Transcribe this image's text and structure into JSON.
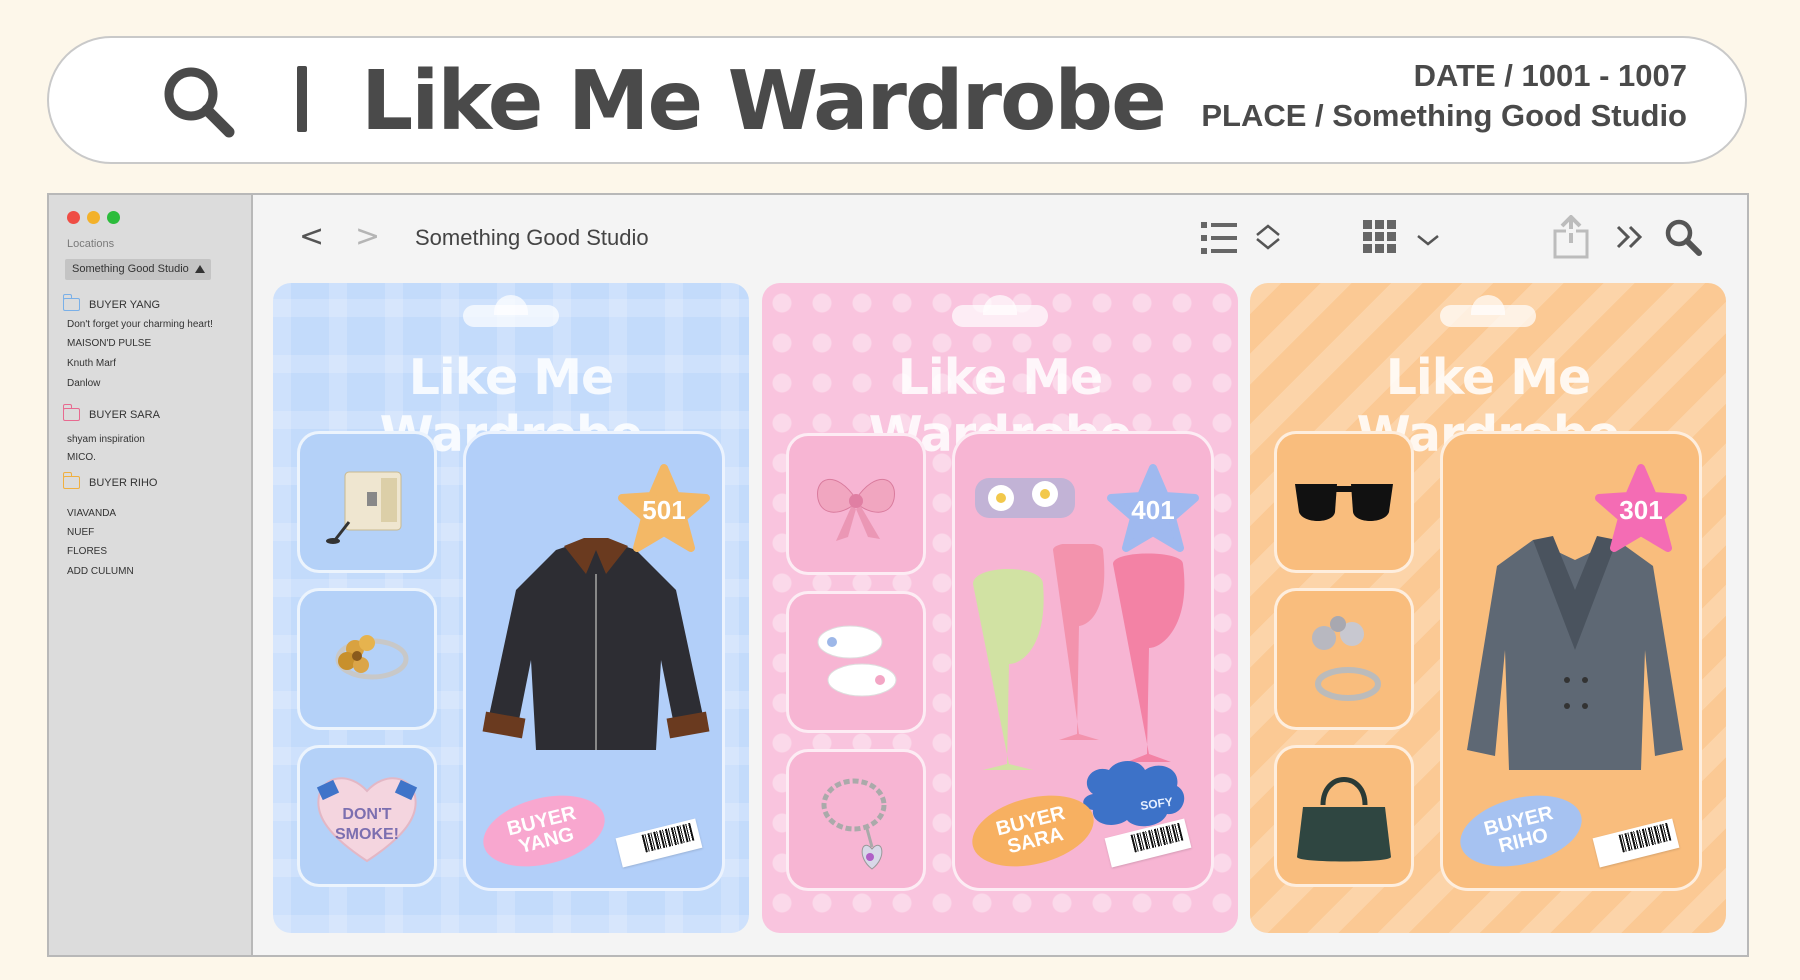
{
  "header": {
    "title": "Like Me Wardrobe",
    "date_line": "DATE / 1001 - 1007",
    "place_line": "PLACE / Something Good Studio"
  },
  "sidebar": {
    "section_label": "Locations",
    "location_select": "Something Good Studio",
    "buyers": [
      {
        "label": "BUYER YANG",
        "folder_color": "#7ab0e8",
        "items": [
          "Don't forget your charming heart!",
          "MAISON'D PULSE",
          "Knuth Marf",
          "Danlow"
        ]
      },
      {
        "label": "BUYER SARA",
        "folder_color": "#e86a90",
        "items": [
          "shyam inspiration",
          "MICO."
        ]
      },
      {
        "label": "BUYER RIHO",
        "folder_color": "#f0b040",
        "items": [
          "VIAVANDA",
          "NUEF",
          "FLORES",
          "ADD CULUMN"
        ]
      }
    ]
  },
  "toolbar": {
    "back": "<",
    "forward": ">",
    "path_title": "Something Good Studio",
    "icons": [
      "list-view-icon",
      "sort-chevrons-icon",
      "grid-view-icon",
      "chevron-down-icon",
      "share-icon",
      "more-icon",
      "search-icon"
    ]
  },
  "cards": [
    {
      "title": "Like Me Wardrobe",
      "number": "501",
      "buyer_line1": "BUYER",
      "buyer_line2": "YANG",
      "bg": "#c3dbfb",
      "star_color": "#f3b866",
      "oval_color": "#f8a7cf",
      "heart_text_1": "DON'T",
      "heart_text_2": "SMOKE!"
    },
    {
      "title": "Like Me Wardrobe",
      "number": "401",
      "buyer_line1": "BUYER",
      "buyer_line2": "SARA",
      "bg": "#f9c4de",
      "star_color": "#9fb9ef",
      "oval_color": "#f7b061",
      "soft_label": "SOFY"
    },
    {
      "title": "Like Me Wardrobe",
      "number": "301",
      "buyer_line1": "BUYER",
      "buyer_line2": "RIHO",
      "bg": "#fbc994",
      "star_color": "#f46cb4",
      "oval_color": "#a6c2f1"
    }
  ]
}
